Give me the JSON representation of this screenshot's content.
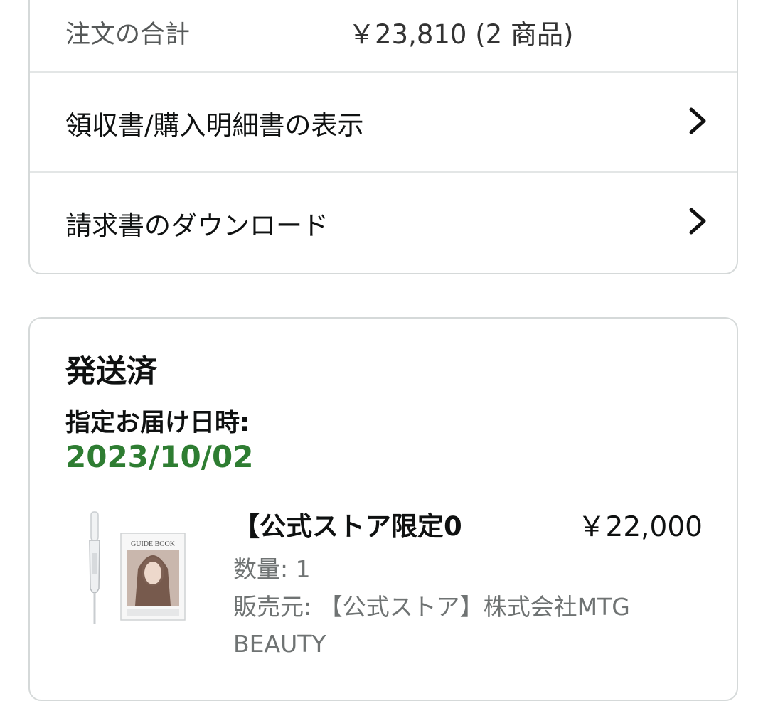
{
  "order_summary": {
    "total_label": "注文の合計",
    "total_value": "￥23,810 (2 商品)",
    "receipt_link": "領収書/購入明細書の表示",
    "invoice_link": "請求書のダウンロード"
  },
  "shipment": {
    "status": "発送済",
    "delivery_label": "指定お届け日時:",
    "delivery_date": "2023/10/02",
    "date_color": "#2e7d32",
    "item": {
      "title": "【公式ストア限定0",
      "price": "￥22,000",
      "quantity": "数量: 1",
      "seller": "販売元: 【公式ストア】株式会社MTG BEAUTY",
      "thumbnail_text": "GUIDE BOOK"
    }
  }
}
